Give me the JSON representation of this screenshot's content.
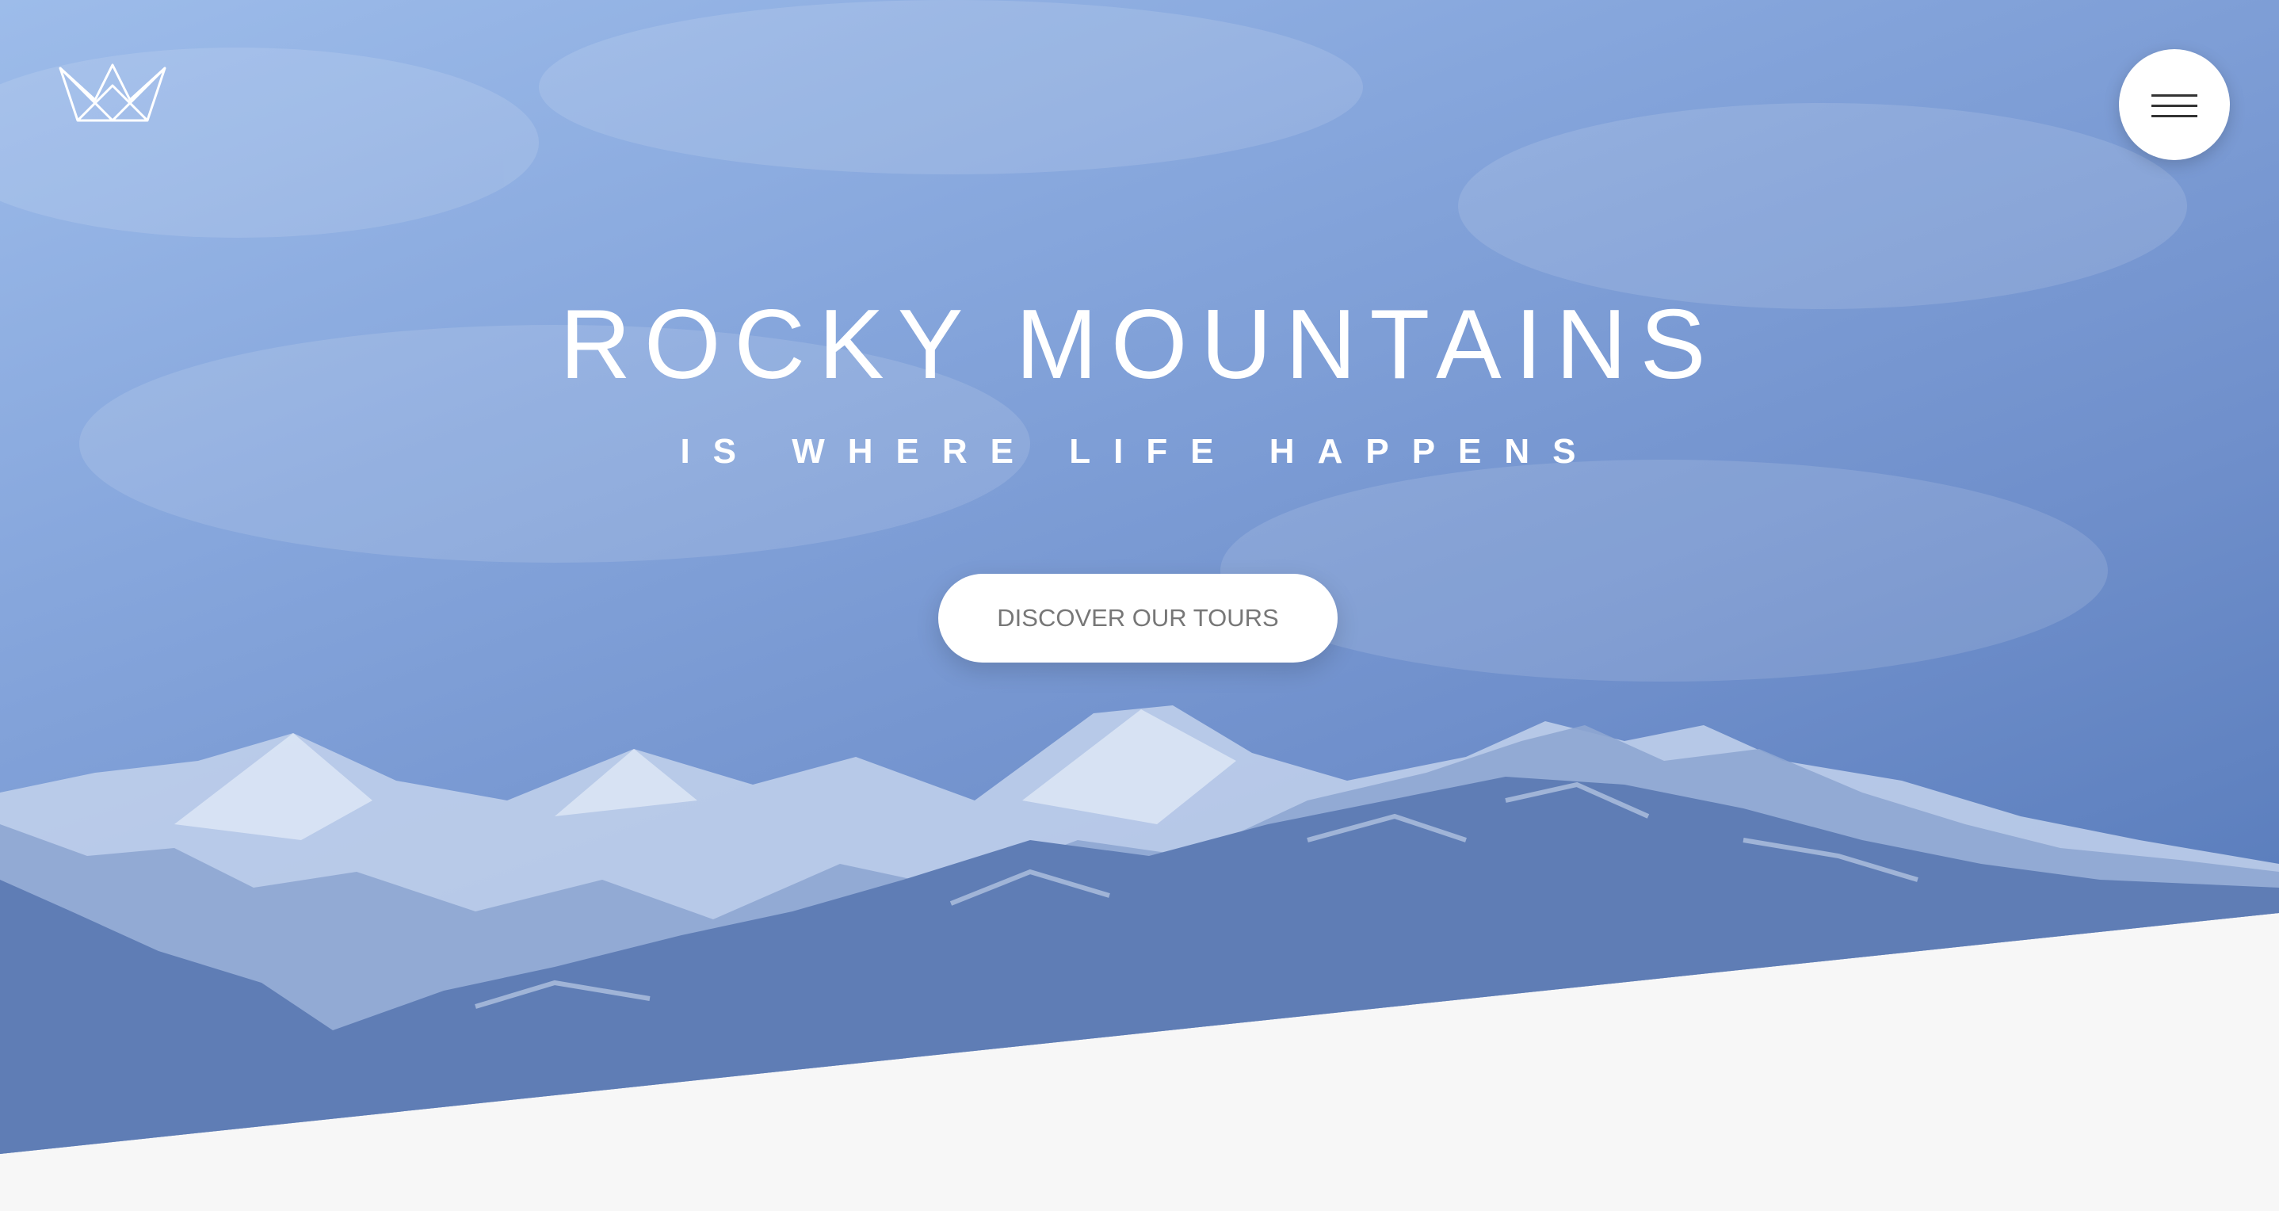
{
  "header": {
    "logo_icon": "crown-icon",
    "menu_icon": "hamburger-menu-icon"
  },
  "hero": {
    "title": "ROCKY MOUNTAINS",
    "subtitle": "IS WHERE LIFE HAPPENS",
    "cta_label": "DISCOVER OUR TOURS"
  },
  "colors": {
    "sky_light": "#9dbcea",
    "sky_dark": "#4d72b3",
    "page_background": "#f7f7f7",
    "button_background": "#ffffff",
    "button_text": "#777777"
  }
}
